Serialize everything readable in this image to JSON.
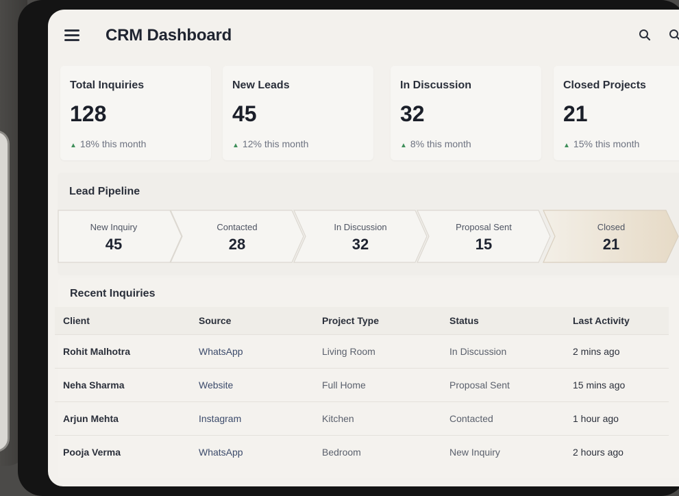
{
  "header": {
    "title": "CRM Dashboard"
  },
  "stats": [
    {
      "label": "Total Inquiries",
      "value": "128",
      "change": "18% this month"
    },
    {
      "label": "New Leads",
      "value": "45",
      "change": "12% this month"
    },
    {
      "label": "In Discussion",
      "value": "32",
      "change": "8% this month"
    },
    {
      "label": "Closed Projects",
      "value": "21",
      "change": "15% this month"
    }
  ],
  "pipeline": {
    "title": "Lead Pipeline",
    "stages": [
      {
        "label": "New Inquiry",
        "value": "45"
      },
      {
        "label": "Contacted",
        "value": "28"
      },
      {
        "label": "In Discussion",
        "value": "32"
      },
      {
        "label": "Proposal Sent",
        "value": "15"
      },
      {
        "label": "Closed",
        "value": "21"
      }
    ]
  },
  "recent": {
    "title": "Recent Inquiries",
    "columns": [
      "Client",
      "Source",
      "Project Type",
      "Status",
      "Last Activity"
    ],
    "rows": [
      [
        "Rohit Malhotra",
        "WhatsApp",
        "Living Room",
        "In Discussion",
        "2 mins ago"
      ],
      [
        "Neha Sharma",
        "Website",
        "Full Home",
        "Proposal Sent",
        "15 mins ago"
      ],
      [
        "Arjun Mehta",
        "Instagram",
        "Kitchen",
        "Contacted",
        "1 hour ago"
      ],
      [
        "Pooja Verma",
        "WhatsApp",
        "Bedroom",
        "New Inquiry",
        "2 hours ago"
      ]
    ]
  },
  "colors": {
    "accent_up": "#3f8f5a",
    "stage_fill": "#f6f5f2",
    "stage_closed_fill": "#ece2d2"
  },
  "icons": [
    "menu-icon",
    "search-icon",
    "search-icon",
    "trend-up-icon"
  ]
}
